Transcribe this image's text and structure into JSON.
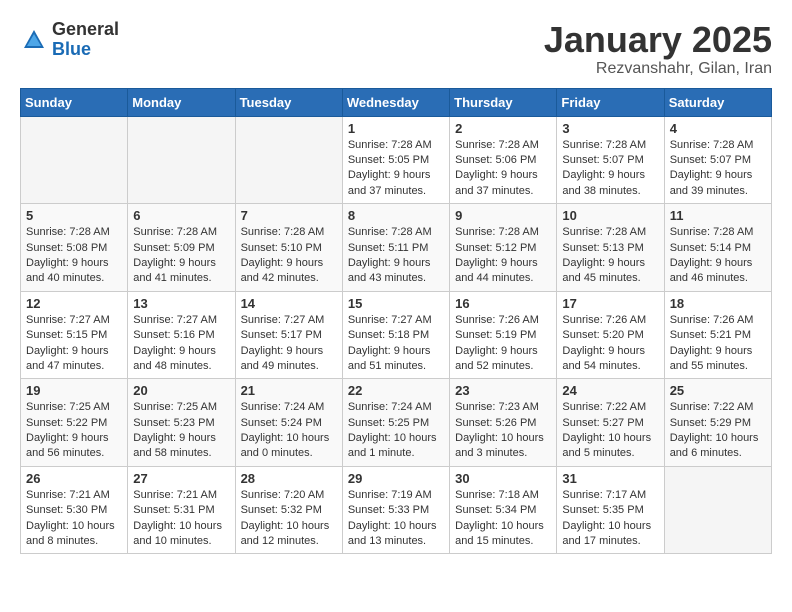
{
  "logo": {
    "general": "General",
    "blue": "Blue"
  },
  "title": "January 2025",
  "subtitle": "Rezvanshahr, Gilan, Iran",
  "weekdays": [
    "Sunday",
    "Monday",
    "Tuesday",
    "Wednesday",
    "Thursday",
    "Friday",
    "Saturday"
  ],
  "weeks": [
    [
      {
        "day": "",
        "info": ""
      },
      {
        "day": "",
        "info": ""
      },
      {
        "day": "",
        "info": ""
      },
      {
        "day": "1",
        "info": "Sunrise: 7:28 AM\nSunset: 5:05 PM\nDaylight: 9 hours and 37 minutes."
      },
      {
        "day": "2",
        "info": "Sunrise: 7:28 AM\nSunset: 5:06 PM\nDaylight: 9 hours and 37 minutes."
      },
      {
        "day": "3",
        "info": "Sunrise: 7:28 AM\nSunset: 5:07 PM\nDaylight: 9 hours and 38 minutes."
      },
      {
        "day": "4",
        "info": "Sunrise: 7:28 AM\nSunset: 5:07 PM\nDaylight: 9 hours and 39 minutes."
      }
    ],
    [
      {
        "day": "5",
        "info": "Sunrise: 7:28 AM\nSunset: 5:08 PM\nDaylight: 9 hours and 40 minutes."
      },
      {
        "day": "6",
        "info": "Sunrise: 7:28 AM\nSunset: 5:09 PM\nDaylight: 9 hours and 41 minutes."
      },
      {
        "day": "7",
        "info": "Sunrise: 7:28 AM\nSunset: 5:10 PM\nDaylight: 9 hours and 42 minutes."
      },
      {
        "day": "8",
        "info": "Sunrise: 7:28 AM\nSunset: 5:11 PM\nDaylight: 9 hours and 43 minutes."
      },
      {
        "day": "9",
        "info": "Sunrise: 7:28 AM\nSunset: 5:12 PM\nDaylight: 9 hours and 44 minutes."
      },
      {
        "day": "10",
        "info": "Sunrise: 7:28 AM\nSunset: 5:13 PM\nDaylight: 9 hours and 45 minutes."
      },
      {
        "day": "11",
        "info": "Sunrise: 7:28 AM\nSunset: 5:14 PM\nDaylight: 9 hours and 46 minutes."
      }
    ],
    [
      {
        "day": "12",
        "info": "Sunrise: 7:27 AM\nSunset: 5:15 PM\nDaylight: 9 hours and 47 minutes."
      },
      {
        "day": "13",
        "info": "Sunrise: 7:27 AM\nSunset: 5:16 PM\nDaylight: 9 hours and 48 minutes."
      },
      {
        "day": "14",
        "info": "Sunrise: 7:27 AM\nSunset: 5:17 PM\nDaylight: 9 hours and 49 minutes."
      },
      {
        "day": "15",
        "info": "Sunrise: 7:27 AM\nSunset: 5:18 PM\nDaylight: 9 hours and 51 minutes."
      },
      {
        "day": "16",
        "info": "Sunrise: 7:26 AM\nSunset: 5:19 PM\nDaylight: 9 hours and 52 minutes."
      },
      {
        "day": "17",
        "info": "Sunrise: 7:26 AM\nSunset: 5:20 PM\nDaylight: 9 hours and 54 minutes."
      },
      {
        "day": "18",
        "info": "Sunrise: 7:26 AM\nSunset: 5:21 PM\nDaylight: 9 hours and 55 minutes."
      }
    ],
    [
      {
        "day": "19",
        "info": "Sunrise: 7:25 AM\nSunset: 5:22 PM\nDaylight: 9 hours and 56 minutes."
      },
      {
        "day": "20",
        "info": "Sunrise: 7:25 AM\nSunset: 5:23 PM\nDaylight: 9 hours and 58 minutes."
      },
      {
        "day": "21",
        "info": "Sunrise: 7:24 AM\nSunset: 5:24 PM\nDaylight: 10 hours and 0 minutes."
      },
      {
        "day": "22",
        "info": "Sunrise: 7:24 AM\nSunset: 5:25 PM\nDaylight: 10 hours and 1 minute."
      },
      {
        "day": "23",
        "info": "Sunrise: 7:23 AM\nSunset: 5:26 PM\nDaylight: 10 hours and 3 minutes."
      },
      {
        "day": "24",
        "info": "Sunrise: 7:22 AM\nSunset: 5:27 PM\nDaylight: 10 hours and 5 minutes."
      },
      {
        "day": "25",
        "info": "Sunrise: 7:22 AM\nSunset: 5:29 PM\nDaylight: 10 hours and 6 minutes."
      }
    ],
    [
      {
        "day": "26",
        "info": "Sunrise: 7:21 AM\nSunset: 5:30 PM\nDaylight: 10 hours and 8 minutes."
      },
      {
        "day": "27",
        "info": "Sunrise: 7:21 AM\nSunset: 5:31 PM\nDaylight: 10 hours and 10 minutes."
      },
      {
        "day": "28",
        "info": "Sunrise: 7:20 AM\nSunset: 5:32 PM\nDaylight: 10 hours and 12 minutes."
      },
      {
        "day": "29",
        "info": "Sunrise: 7:19 AM\nSunset: 5:33 PM\nDaylight: 10 hours and 13 minutes."
      },
      {
        "day": "30",
        "info": "Sunrise: 7:18 AM\nSunset: 5:34 PM\nDaylight: 10 hours and 15 minutes."
      },
      {
        "day": "31",
        "info": "Sunrise: 7:17 AM\nSunset: 5:35 PM\nDaylight: 10 hours and 17 minutes."
      },
      {
        "day": "",
        "info": ""
      }
    ]
  ]
}
